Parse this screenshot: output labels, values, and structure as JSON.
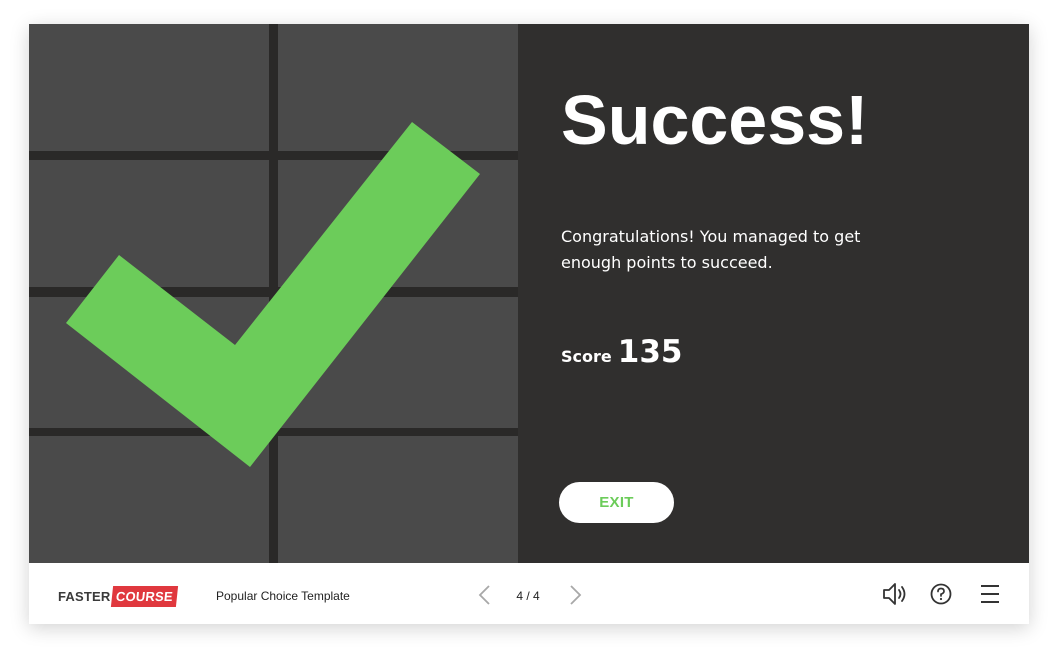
{
  "slide": {
    "title": "Success!",
    "message": "Congratulations! You managed to get enough points to succeed.",
    "score_label": "Score",
    "score_value": "135",
    "exit_label": "EXIT"
  },
  "footer": {
    "logo": {
      "part1": "FASTER",
      "part2": "COURSE"
    },
    "course_title": "Popular Choice Template",
    "page_counter": "4 / 4",
    "icons": {
      "prev": "chevron-left-icon",
      "next": "chevron-right-icon",
      "sound": "speaker-icon",
      "help": "help-icon",
      "menu": "menu-icon"
    }
  },
  "colors": {
    "accent_green": "#6ccc5a",
    "panel_dark": "#302f2e",
    "tile_gray": "#4a4a4a",
    "logo_red": "#e0383e"
  }
}
